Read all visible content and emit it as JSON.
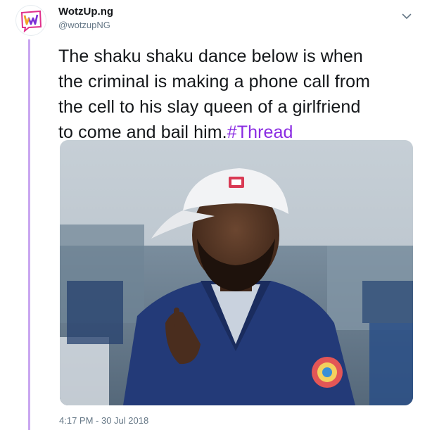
{
  "account": {
    "display_name": "WotzUp.ng",
    "handle": "@wotzupNG",
    "avatar_letter": "W"
  },
  "tweet": {
    "lines": [
      "The shaku shaku dance below is when",
      "the criminal is making a phone call from",
      "the cell to his slay queen of a girlfriend",
      "to come and bail him."
    ],
    "hashtag": "#Thread",
    "timestamp": "4:17 PM - 30 Jul 2018"
  },
  "icons": {
    "caret": "chevron-down-icon"
  },
  "colors": {
    "hashtag": "#8a2be2",
    "thread_line": "#c9a6f0",
    "brand_pink": "#e0318c",
    "brand_purple": "#7b2fd6"
  }
}
